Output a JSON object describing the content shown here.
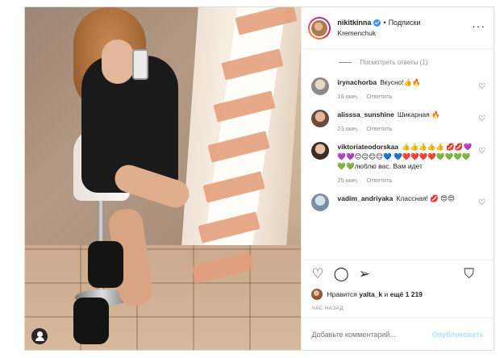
{
  "header": {
    "username": "nikitkinna",
    "separator": "•",
    "follow_label": "Подписки",
    "location": "Kremenchuk",
    "more_icon": "ellipsis-icon"
  },
  "view_replies": "Посмотреть ответы (1)",
  "comments": [
    {
      "username": "irynachorba",
      "text": "Вкусно!👍🔥",
      "time": "18 мин.",
      "reply": "Ответить"
    },
    {
      "username": "alisssa_sunshine",
      "text": "Шикарная 🔥",
      "time": "23 мин.",
      "reply": "Ответить"
    },
    {
      "username": "viktoriateodorskaa",
      "text": "👍👍👍👍👍 💋💋💜💜💜😊😊😊😊💙 💙❤️❤️❤️❤️💚💚💚💚 💚💚люблю вас. Вам идет",
      "time": "25 мин.",
      "reply": "Ответить"
    },
    {
      "username": "vadim_andriyaka",
      "text": "Классная! 💋 😍😍",
      "time": "",
      "reply": ""
    }
  ],
  "likes": {
    "prefix": "Нравится",
    "user": "yalta_k",
    "middle": "и",
    "count_text": "ещё 1 219"
  },
  "timestamp": "ЧАС НАЗАД",
  "comment_box": {
    "placeholder": "Добавьте комментарий...",
    "publish_label": "Опубликовать"
  },
  "colors": {
    "verified_blue": "#3897f0",
    "publish_disabled": "#b2dffc",
    "tape": "#e39d7b"
  }
}
